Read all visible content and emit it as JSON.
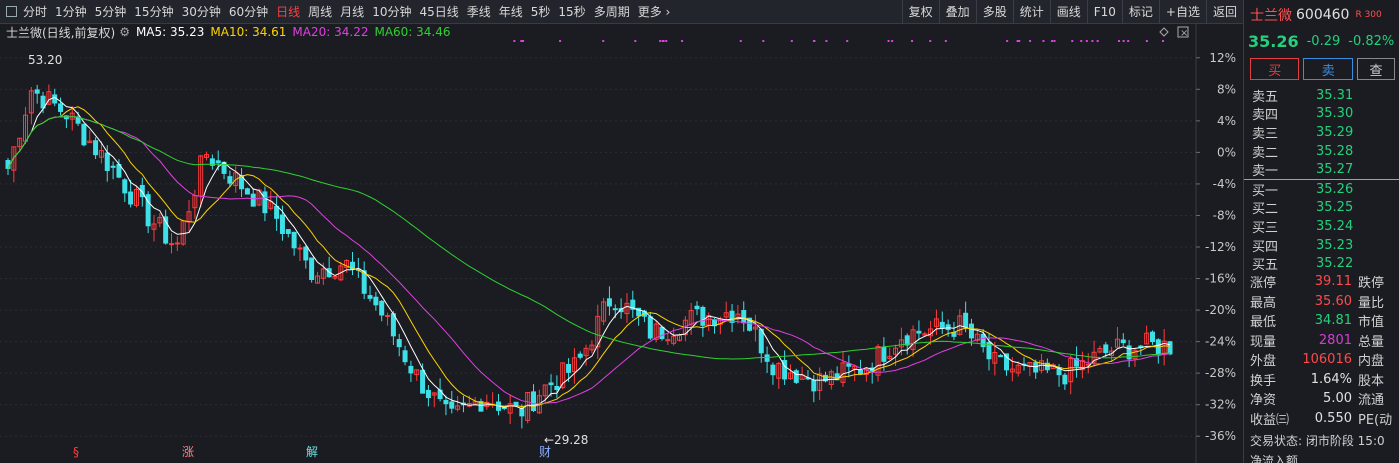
{
  "topbar": {
    "period_tabs": [
      "分时",
      "1分钟",
      "5分钟",
      "15分钟",
      "30分钟",
      "60分钟",
      "日线",
      "周线",
      "月线",
      "10分钟",
      "45日线",
      "季线",
      "年线",
      "5秒",
      "15秒",
      "多周期",
      "更多 ›"
    ],
    "active_tab": "日线",
    "tools": [
      "复权",
      "叠加",
      "多股",
      "统计",
      "画线",
      "F10",
      "标记",
      "+自选",
      "返回"
    ]
  },
  "legend": {
    "title": "士兰微(日线,前复权)",
    "ma5": "MA5: 35.23",
    "ma10": "MA10: 34.61",
    "ma20": "MA20: 34.22",
    "ma60": "MA60: 34.46",
    "colors": {
      "ma5": "#ffffff",
      "ma10": "#ffd400",
      "ma20": "#e040e0",
      "ma60": "#30d030"
    }
  },
  "chart_data": {
    "type": "candlestick",
    "y_axis_percent_ticks": [
      "12%",
      "8%",
      "4%",
      "0%",
      "-4%",
      "-8%",
      "-12%",
      "-16%",
      "-20%",
      "-24%",
      "-28%",
      "-32%",
      "-36%"
    ],
    "high_label": "53.20",
    "low_label": "←29.28",
    "markers": [
      "§",
      "涨",
      "解",
      "财"
    ],
    "ylim_percent": [
      -38,
      14
    ]
  },
  "quote": {
    "name": "士兰微",
    "code": "600460",
    "badge": "R 300",
    "price": "35.26",
    "change": "-0.29",
    "pct": "-0.82%",
    "buttons": {
      "buy": "买",
      "sell": "卖",
      "query": "查"
    },
    "asks": [
      {
        "l": "卖五",
        "v": "35.31"
      },
      {
        "l": "卖四",
        "v": "35.30"
      },
      {
        "l": "卖三",
        "v": "35.29"
      },
      {
        "l": "卖二",
        "v": "35.28"
      },
      {
        "l": "卖一",
        "v": "35.27"
      }
    ],
    "bids": [
      {
        "l": "买一",
        "v": "35.26"
      },
      {
        "l": "买二",
        "v": "35.25"
      },
      {
        "l": "买三",
        "v": "35.24"
      },
      {
        "l": "买四",
        "v": "35.23"
      },
      {
        "l": "买五",
        "v": "35.22"
      }
    ],
    "stats": [
      {
        "l": "涨停",
        "v": "39.11",
        "c": "red",
        "l2": "跌停"
      },
      {
        "l": "最高",
        "v": "35.60",
        "c": "red",
        "l2": "量比"
      },
      {
        "l": "最低",
        "v": "34.81",
        "c": "green",
        "l2": "市值"
      },
      {
        "l": "现量",
        "v": "2801",
        "c": "purple",
        "l2": "总量"
      },
      {
        "l": "外盘",
        "v": "106016",
        "c": "red",
        "l2": "内盘"
      },
      {
        "l": "换手",
        "v": "1.64%",
        "c": "white",
        "l2": "股本"
      },
      {
        "l": "净资",
        "v": "5.00",
        "c": "white",
        "l2": "流通"
      },
      {
        "l": "收益㈢",
        "v": "0.550",
        "c": "white",
        "l2": "PE(动"
      }
    ],
    "trade_state": "交易状态: 闭市阶段 15:0",
    "net_inflow": "净流入额"
  }
}
